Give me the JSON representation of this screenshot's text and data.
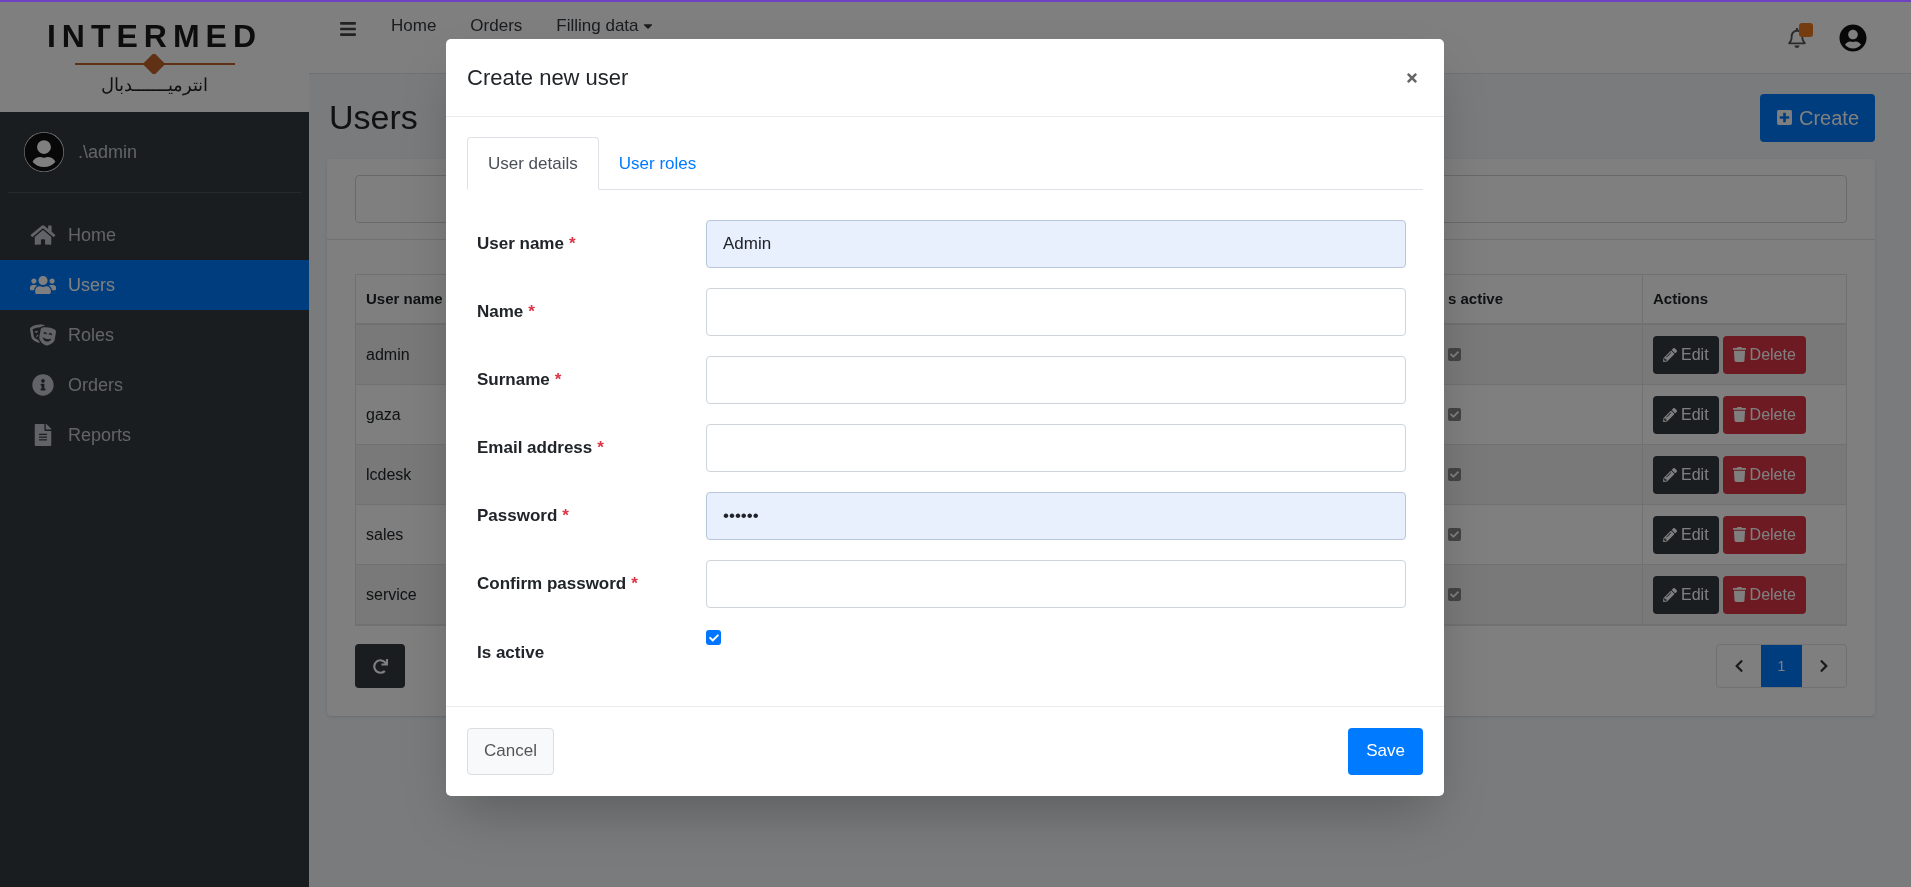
{
  "logo": {
    "name": "INTERMED",
    "arabic": "انترميـــــــدبال"
  },
  "sidebar": {
    "user": ".\\admin",
    "items": [
      {
        "label": "Home",
        "selected": false
      },
      {
        "label": "Users",
        "selected": true
      },
      {
        "label": "Roles",
        "selected": false
      },
      {
        "label": "Orders",
        "selected": false
      },
      {
        "label": "Reports",
        "selected": false
      }
    ]
  },
  "navbar": {
    "links": [
      "Home",
      "Orders"
    ],
    "dropdown": "Filling data",
    "notification": true
  },
  "page": {
    "title": "Users",
    "create_button": "Create"
  },
  "table": {
    "columns": [
      "User name",
      "s active",
      "Actions"
    ],
    "rows": [
      {
        "user_name": "admin",
        "active": true,
        "edit": "Edit",
        "delete": "Delete"
      },
      {
        "user_name": "gaza",
        "active": true,
        "edit": "Edit",
        "delete": "Delete"
      },
      {
        "user_name": "lcdesk",
        "active": true,
        "edit": "Edit",
        "delete": "Delete"
      },
      {
        "user_name": "sales",
        "active": true,
        "edit": "Edit",
        "delete": "Delete"
      },
      {
        "user_name": "service",
        "active": true,
        "edit": "Edit",
        "delete": "Delete"
      }
    ]
  },
  "pagination": {
    "pages": [
      {
        "label": "1",
        "selected": true
      }
    ]
  },
  "modal": {
    "title": "Create new user",
    "tabs": [
      {
        "label": "User details",
        "selected": true
      },
      {
        "label": "User roles",
        "selected": false
      }
    ],
    "fields": [
      {
        "kind": "text",
        "label": "User name",
        "mark": "*",
        "value": "Admin",
        "autofilled": true
      },
      {
        "kind": "text",
        "label": "Name",
        "mark": "*",
        "autofilled": false
      },
      {
        "kind": "text",
        "label": "Surname",
        "mark": "*",
        "autofilled": false
      },
      {
        "kind": "text",
        "label": "Email address",
        "mark": "*",
        "autofilled": false
      },
      {
        "kind": "text",
        "label": "Password",
        "mark": "*",
        "value": "••••••",
        "autofilled": true
      },
      {
        "kind": "text",
        "label": "Confirm password",
        "mark": "*",
        "autofilled": false
      },
      {
        "kind": "checkbox",
        "label": "Is active",
        "checked": true
      }
    ],
    "cancel": "Cancel",
    "save": "Save"
  }
}
